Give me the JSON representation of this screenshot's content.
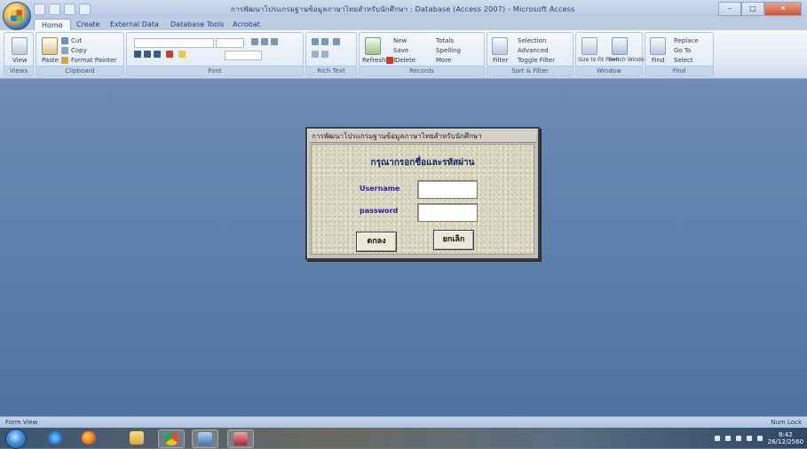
{
  "window": {
    "title": "การพัฒนาโปรแกรมฐานข้อมูลภาษาไทยสำหรับนักศึกษา : Database (Access 2007) - Microsoft Access",
    "controls": {
      "minimize": "–",
      "maximize": "□",
      "close": "✕"
    }
  },
  "tabs": [
    "Home",
    "Create",
    "External Data",
    "Database Tools",
    "Acrobat"
  ],
  "ribbon": {
    "groups": [
      {
        "label": "Views",
        "buttons": [
          "View"
        ]
      },
      {
        "label": "Clipboard",
        "buttons": [
          "Paste",
          "Cut",
          "Copy",
          "Format Painter"
        ]
      },
      {
        "label": "Font",
        "buttons": []
      },
      {
        "label": "Rich Text",
        "buttons": []
      },
      {
        "label": "Records",
        "buttons": [
          "Refresh All",
          "New",
          "Save",
          "Delete",
          "Totals",
          "Spelling",
          "More"
        ]
      },
      {
        "label": "Sort & Filter",
        "buttons": [
          "Filter",
          "Selection",
          "Advanced",
          "Toggle Filter"
        ]
      },
      {
        "label": "Window",
        "buttons": [
          "Size to Fit Form",
          "Switch Windows"
        ]
      },
      {
        "label": "Find",
        "buttons": [
          "Find",
          "Replace",
          "Go To",
          "Select"
        ]
      }
    ]
  },
  "dialog": {
    "title": "การพัฒนาโปรแกรมฐานข้อมูลภาษาไทยสำหรับนักศึกษา",
    "prompt": "กรุณากรอกชื่อและรหัสผ่าน",
    "username_label": "Username",
    "password_label": "password",
    "username_value": "",
    "password_value": "",
    "ok_label": "ตกลง",
    "cancel_label": "ยกเลิก"
  },
  "statusbar": {
    "left": "Form View",
    "right": "Num Lock"
  },
  "taskbar": {
    "items": [
      "start",
      "internet-explorer",
      "firefox",
      "file-explorer",
      "chrome",
      "media-player",
      "access"
    ],
    "clock": {
      "time": "8:42",
      "date": "26/12/2560"
    }
  },
  "colors": {
    "workspace": "#5f81ad",
    "dialog_body": "#dbd9c3",
    "label_blue": "#2b1ea8",
    "prompt_navy": "#14235e"
  }
}
